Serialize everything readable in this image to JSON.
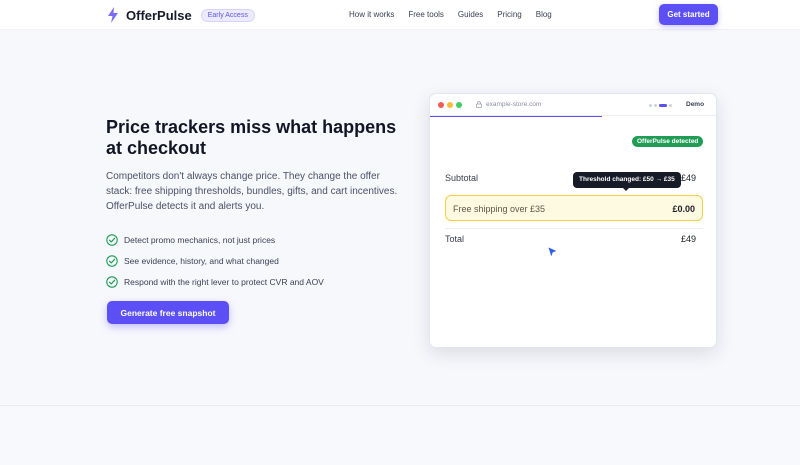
{
  "header": {
    "brand": "OfferPulse",
    "badge": "Early Access",
    "nav": [
      "How it works",
      "Free tools",
      "Guides",
      "Pricing",
      "Blog"
    ],
    "cta": "Get started"
  },
  "hero": {
    "title": "Price trackers miss what happens at checkout",
    "description": "Competitors don't always change price. They change the offer stack: free shipping thresholds, bundles, gifts, and cart incentives. OfferPulse detects it and alerts you.",
    "features": [
      "Detect promo mechanics, not just prices",
      "See evidence, history, and what changed",
      "Respond with the right lever to protect CVR and AOV"
    ],
    "cta": "Generate free snapshot"
  },
  "demo": {
    "url": "example-store.com",
    "label": "Demo",
    "detected_badge": "OfferPulse detected",
    "tooltip": "Threshold changed: £50 → £35",
    "rows": {
      "subtotal": {
        "label": "Subtotal",
        "value": "£49"
      },
      "shipping": {
        "label": "Free shipping over £35",
        "value": "£0.00"
      },
      "total": {
        "label": "Total",
        "value": "£49"
      }
    }
  },
  "colors": {
    "accent": "#5b4ff5",
    "success": "#1f9d55",
    "highlight_border": "#f0cf46",
    "highlight_bg": "#fef9e1"
  },
  "icons": {
    "logo": "lightning-bolt-icon",
    "feature": "check-circle-icon",
    "url": "lock-icon",
    "cursor": "cursor-pointer-icon"
  }
}
